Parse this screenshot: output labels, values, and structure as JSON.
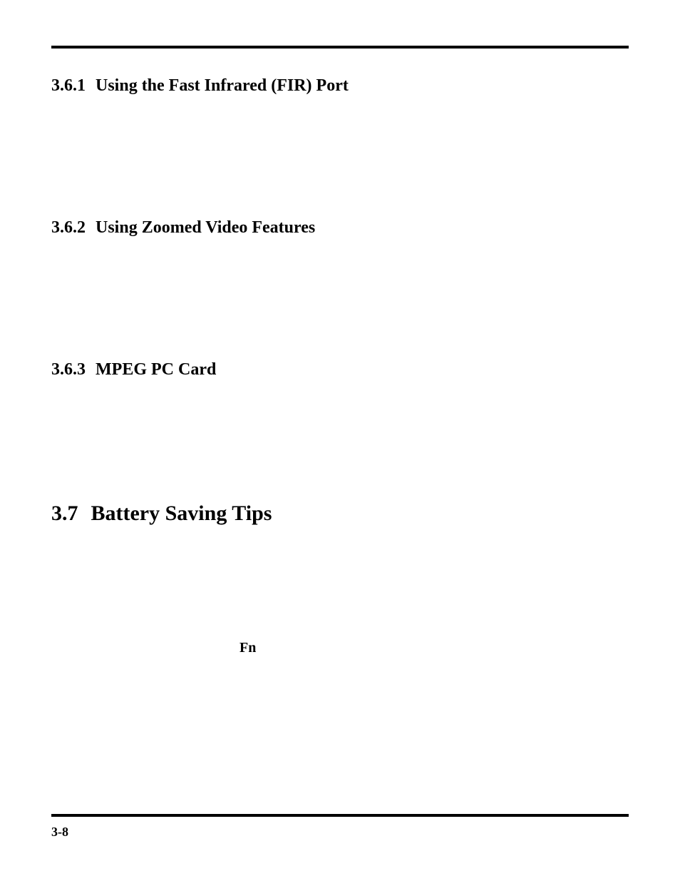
{
  "page": {
    "number": "3-8"
  },
  "sections": [
    {
      "num": "3.6.1",
      "title": "Using the Fast Infrared (FIR) Port"
    },
    {
      "num": "3.6.2",
      "title": "Using Zoomed Video Features"
    },
    {
      "num": "3.6.3",
      "title": "MPEG PC Card"
    }
  ],
  "heading_37": {
    "num": "3.7",
    "title": "Battery Saving Tips"
  },
  "inline": {
    "fn": "Fn"
  }
}
